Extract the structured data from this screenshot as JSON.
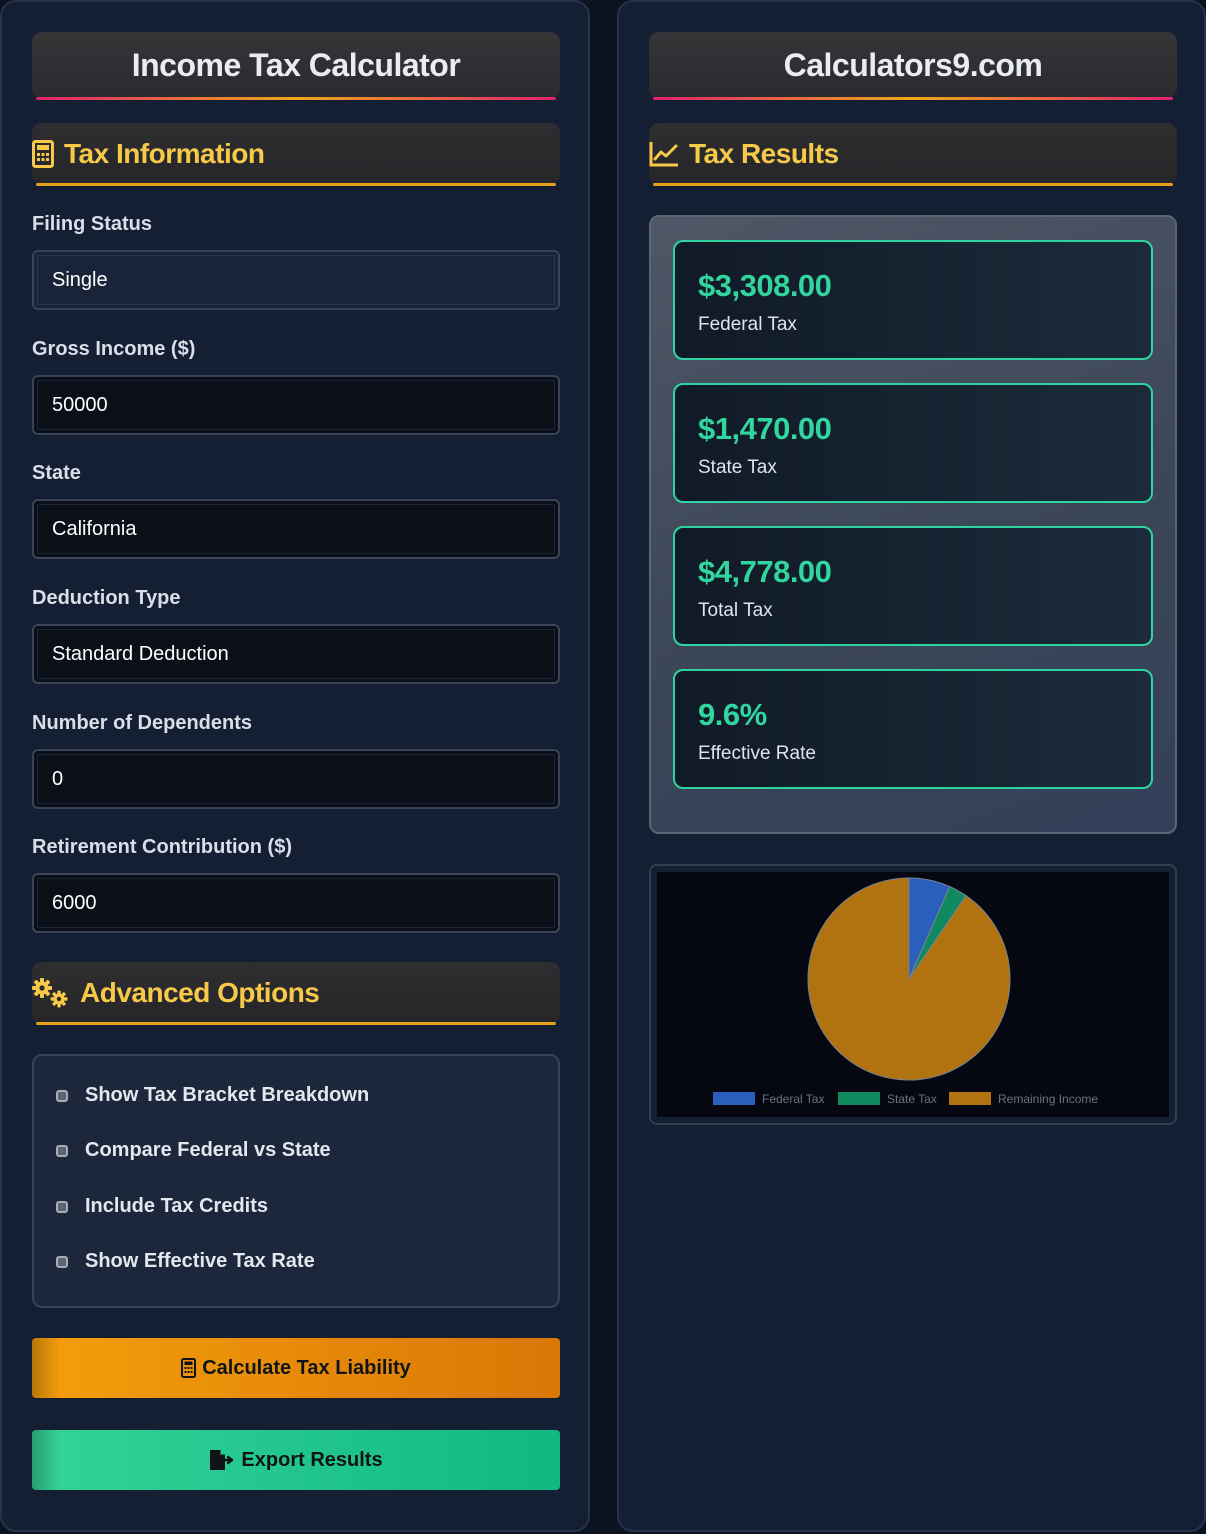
{
  "left": {
    "title": "Income Tax Calculator",
    "section_tax_info": "Tax Information",
    "fields": [
      {
        "label": "Filing Status",
        "value": "Single"
      },
      {
        "label": "Gross Income ($)",
        "value": "50000"
      },
      {
        "label": "State",
        "value": "California"
      },
      {
        "label": "Deduction Type",
        "value": "Standard Deduction"
      },
      {
        "label": "Number of Dependents",
        "value": "0"
      },
      {
        "label": "Retirement Contribution ($)",
        "value": "6000"
      }
    ],
    "section_advanced": "Advanced Options",
    "options": [
      {
        "label": "Show Tax Bracket Breakdown"
      },
      {
        "label": "Compare Federal vs State"
      },
      {
        "label": "Include Tax Credits"
      },
      {
        "label": "Show Effective Tax Rate"
      }
    ],
    "calculate_label": "Calculate Tax Liability",
    "export_label": "Export Results"
  },
  "right": {
    "title": "Calculators9.com",
    "section_results": "Tax Results",
    "results": [
      {
        "value": "$3,308.00",
        "label": "Federal Tax"
      },
      {
        "value": "$1,470.00",
        "label": "State Tax"
      },
      {
        "value": "$4,778.00",
        "label": "Total Tax"
      },
      {
        "value": "9.6%",
        "label": "Effective Rate"
      }
    ]
  },
  "colors": {
    "accent_gold": "#f7c948",
    "accent_green": "#31d69f",
    "federal": "#2b5fbd",
    "state": "#0f8a5f",
    "remaining": "#b07310"
  },
  "chart_data": {
    "type": "pie",
    "categories": [
      "Federal Tax",
      "State Tax",
      "Remaining Income"
    ],
    "values": [
      3308,
      1470,
      45222
    ],
    "legend_position": "bottom"
  }
}
